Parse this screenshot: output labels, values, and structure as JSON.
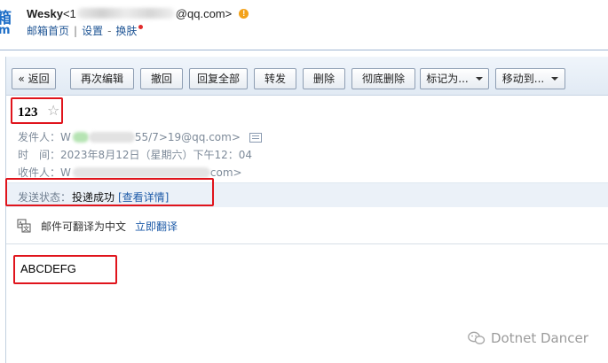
{
  "header": {
    "logo_chars": [
      "箱",
      "m"
    ],
    "user_name": "Wesky",
    "email_prefix": "<1",
    "email_suffix": "@qq.com>",
    "links": [
      "邮箱首页",
      "设置",
      "换肤"
    ],
    "link_separators": [
      "|",
      "-"
    ]
  },
  "toolbar": {
    "buttons": [
      "« 返回",
      "再次编辑",
      "撤回",
      "回复全部",
      "转发",
      "删除",
      "彻底删除",
      "标记为...",
      "移动到..."
    ]
  },
  "message": {
    "subject": "123",
    "sender_label": "发件人：",
    "sender_visible_start": "W",
    "sender_visible_end": "55/7>19@qq.com>",
    "time_label": "时　间：",
    "time_value": "2023年8月12日（星期六）下午12：04",
    "recipient_label": "收件人：",
    "recipient_visible_start": "W",
    "recipient_visible_end": "com>"
  },
  "status": {
    "label": "发送状态：",
    "value": "投递成功",
    "detail_link": "[查看详情]"
  },
  "translate": {
    "text": "邮件可翻译为中文",
    "link": "立即翻译"
  },
  "body": {
    "text": "ABCDEFG"
  },
  "watermark": {
    "text": "Dotnet Dancer"
  },
  "colors": {
    "link_blue": "#1e5494",
    "highlight_red": "#e0141c",
    "warn_orange": "#f3a21a"
  }
}
